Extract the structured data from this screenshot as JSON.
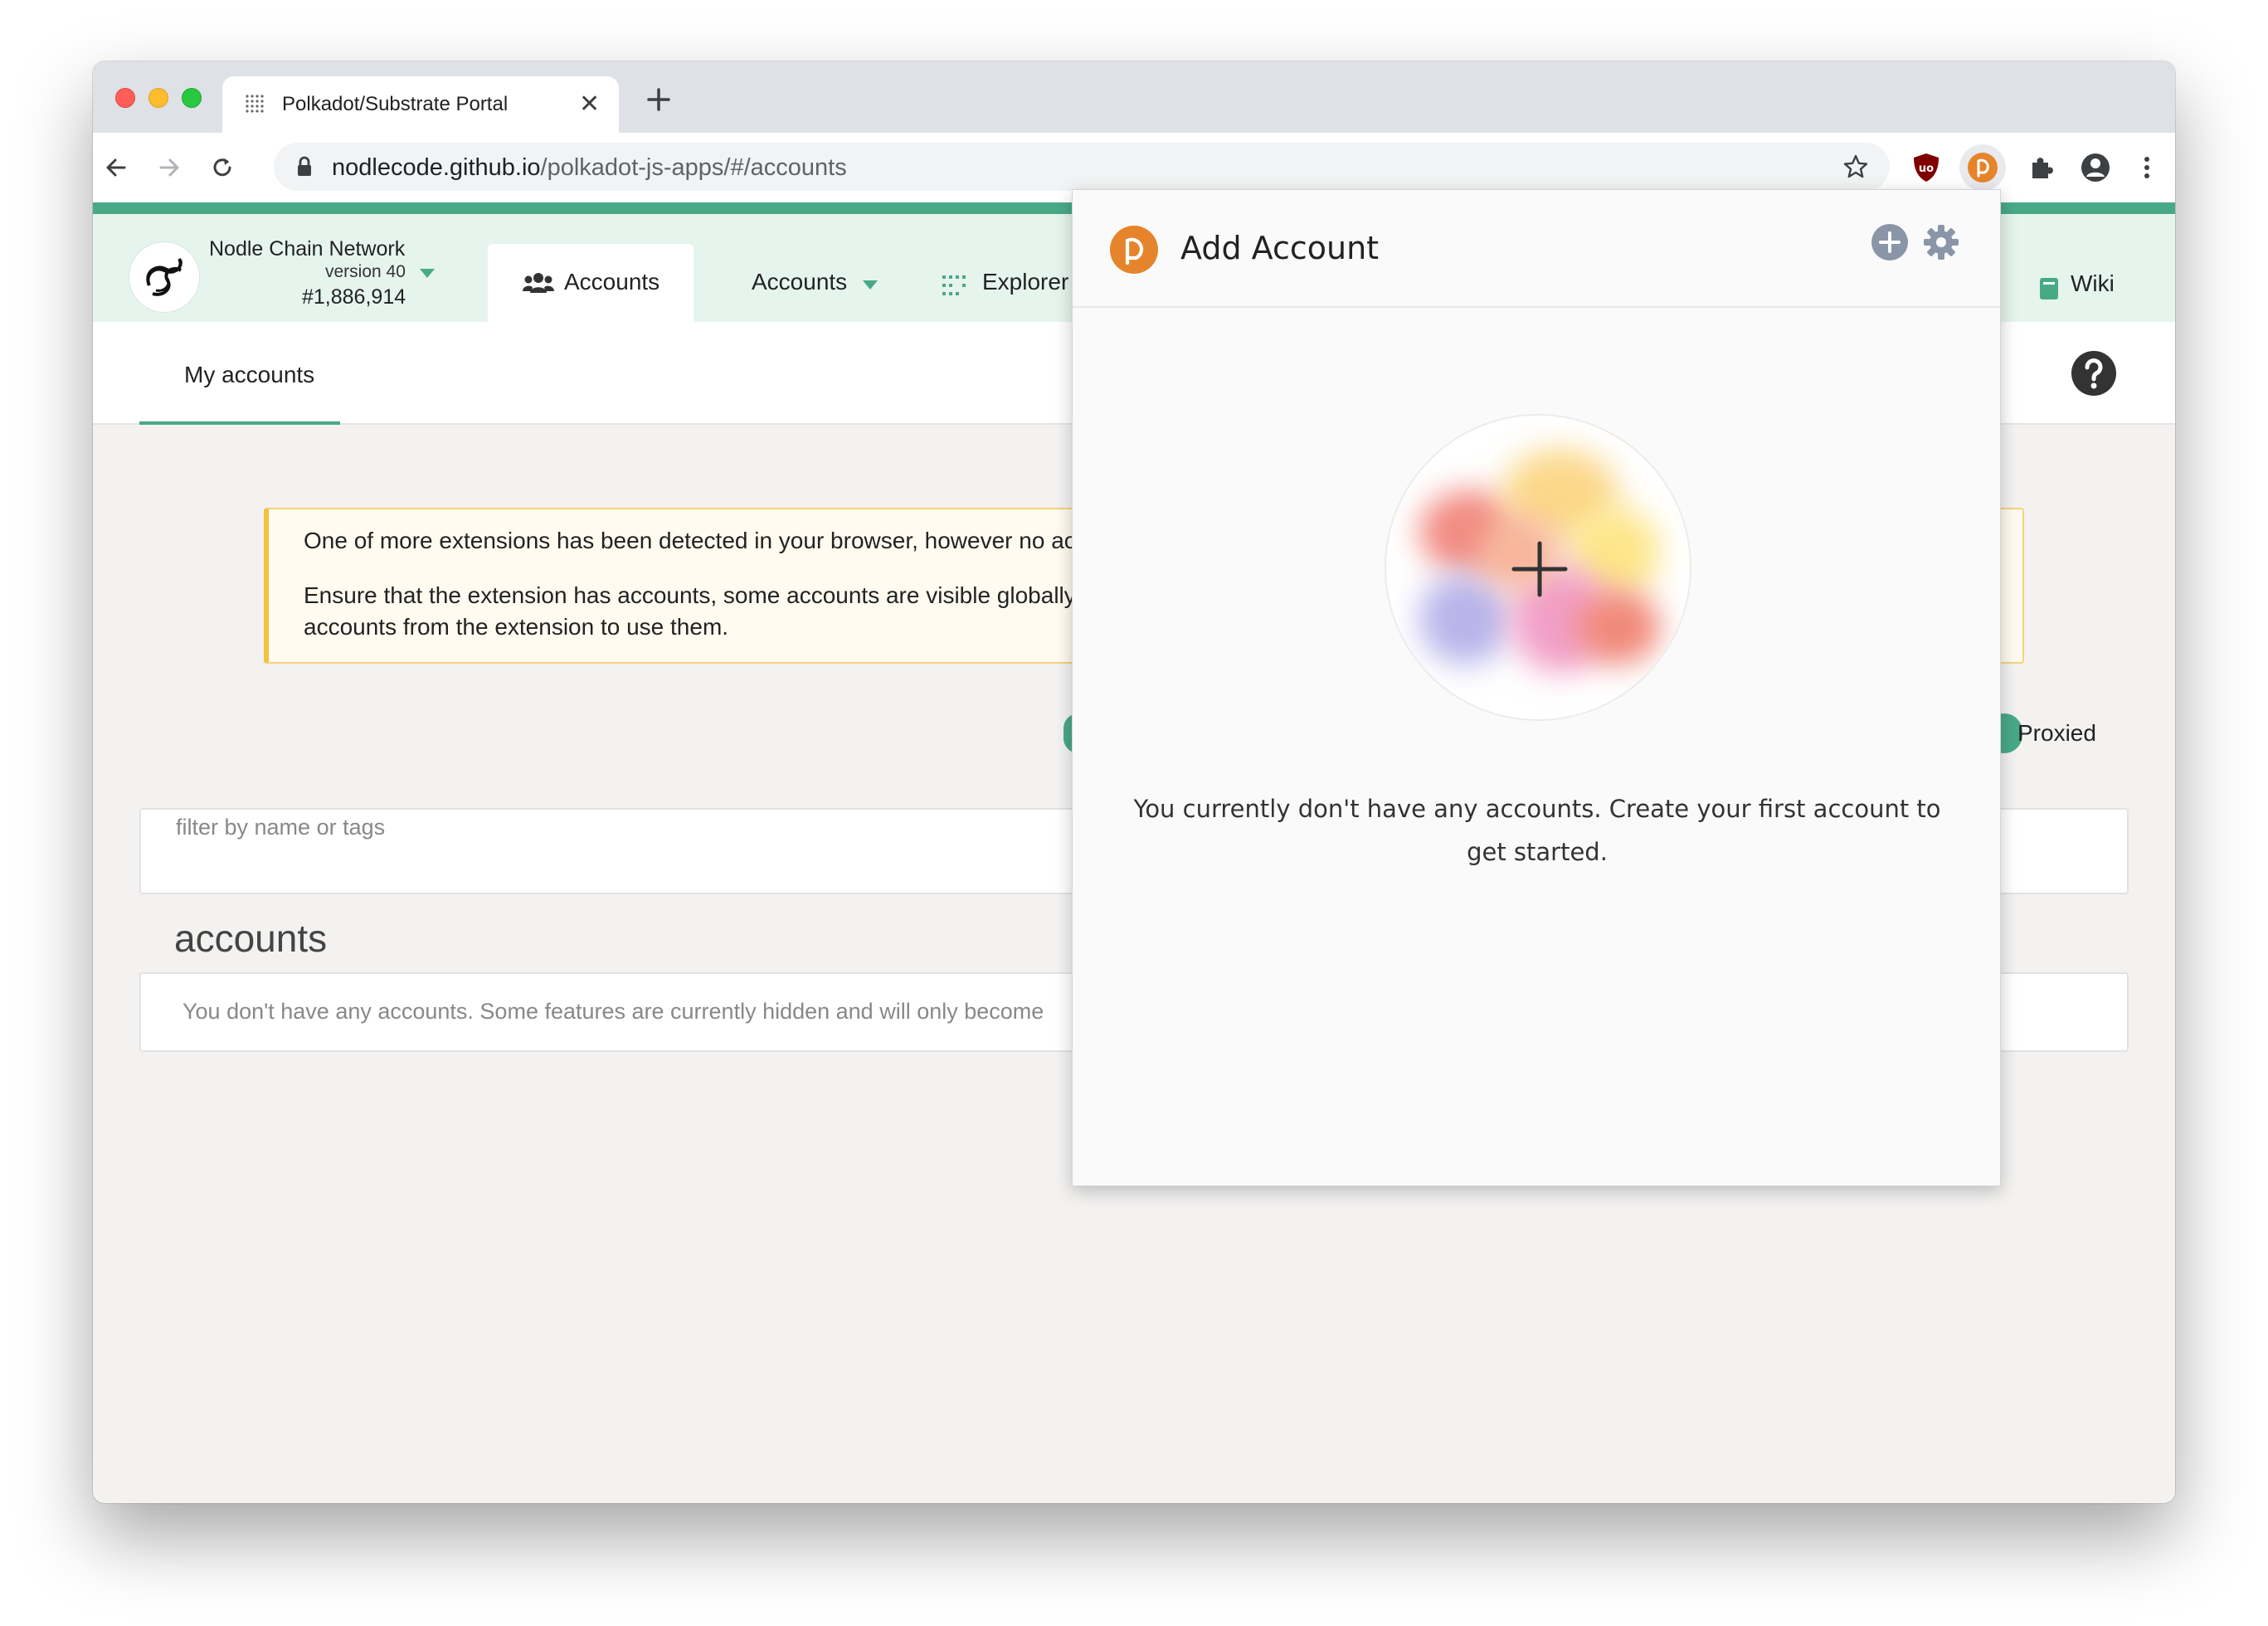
{
  "browser": {
    "tab_title": "Polkadot/Substrate Portal",
    "url_host": "nodlecode.github.io",
    "url_path": "/polkadot-js-apps/#/accounts"
  },
  "app": {
    "chain": {
      "name": "Nodle Chain Network",
      "version": "version 40",
      "block": "#1,886,914"
    },
    "nav": {
      "accounts_active_label": "Accounts",
      "accounts_menu_label": "Accounts",
      "explorer_label": "Explorer",
      "wiki_label": "Wiki"
    },
    "subtabs": {
      "my_accounts": "My accounts"
    },
    "warning": {
      "line1": "One of more extensions has been detected in your browser, however no ac",
      "line2": "Ensure that the extension has accounts, some accounts are visible globally",
      "line3": "accounts from the extension to use them."
    },
    "proxied_label": "Proxied",
    "filter": {
      "placeholder": "filter by name or tags"
    },
    "accounts": {
      "heading": "accounts",
      "empty_text": "You don't have any accounts. Some features are currently hidden and will only become"
    },
    "accent_color": "#48a987"
  },
  "popup": {
    "title": "Add Account",
    "message": "You currently don't have any accounts. Create your first account to get started.",
    "brand_color": "#e6842c"
  }
}
